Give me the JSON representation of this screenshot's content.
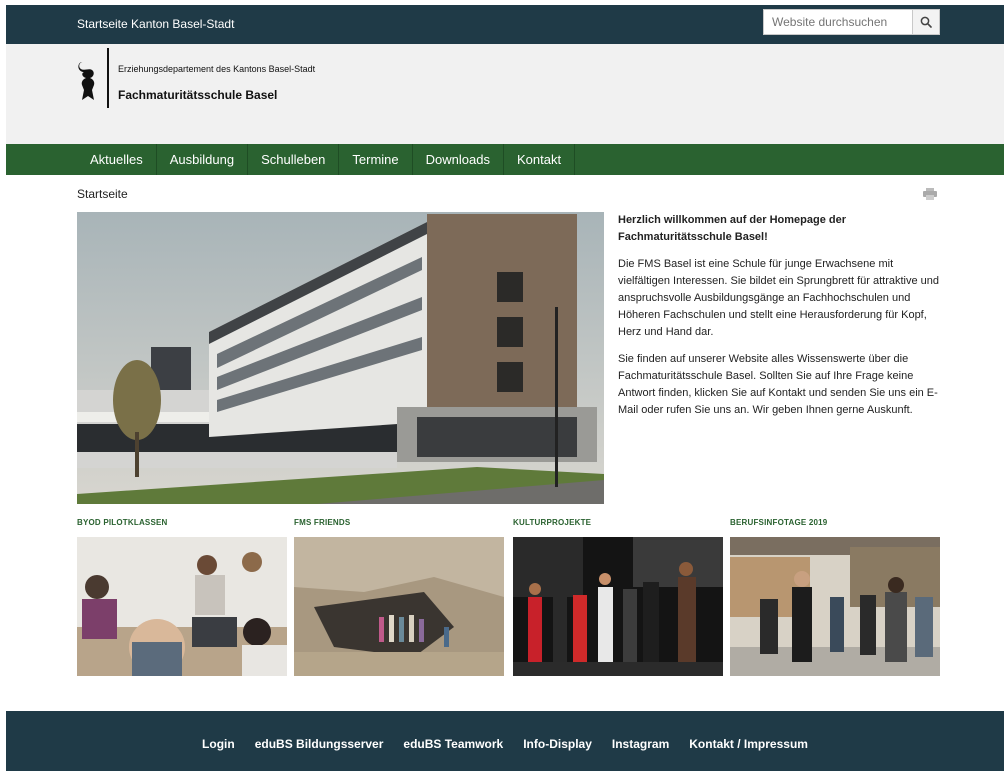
{
  "topbar": {
    "site_link": "Startseite Kanton Basel-Stadt",
    "search": {
      "placeholder": "Website durchsuchen",
      "button_icon": "search-icon"
    }
  },
  "header": {
    "department": "Erziehungsdepartement des Kantons Basel-Stadt",
    "school": "Fachmaturitätsschule Basel",
    "logo_icon": "baselstab-logo"
  },
  "nav": {
    "items": [
      {
        "label": "Aktuelles"
      },
      {
        "label": "Ausbildung"
      },
      {
        "label": "Schulleben"
      },
      {
        "label": "Termine"
      },
      {
        "label": "Downloads"
      },
      {
        "label": "Kontakt"
      }
    ]
  },
  "breadcrumb": "Startseite",
  "print_icon": "print-icon",
  "intro": {
    "heading": "Herzlich willkommen auf der Homepage der Fachmaturitätsschule Basel!",
    "p1": "Die FMS Basel ist eine Schule für junge Erwachsene mit vielfältigen Interessen. Sie bildet ein Sprungbrett für attraktive und anspruchsvolle Ausbildungsgänge an Fachhochschulen und Höheren Fachschulen und stellt eine Herausforderung für Kopf, Herz und Hand dar.",
    "p2": "Sie finden auf unserer Website alles Wissenswerte über die Fachmaturitätsschule Basel. Sollten Sie auf Ihre Frage keine Antwort finden, klicken Sie auf Kontakt und senden Sie uns ein E-Mail oder rufen Sie uns an. Wir geben Ihnen gerne Auskunft."
  },
  "tiles": [
    {
      "title": "BYOD PILOTKLASSEN"
    },
    {
      "title": "FMS FRIENDS"
    },
    {
      "title": "KULTURPROJEKTE"
    },
    {
      "title": "BERUFSINFOTAGE 2019"
    }
  ],
  "footer": {
    "links": [
      {
        "label": "Login"
      },
      {
        "label": "eduBS Bildungsserver"
      },
      {
        "label": "eduBS Teamwork"
      },
      {
        "label": "Info-Display"
      },
      {
        "label": "Instagram"
      },
      {
        "label": "Kontakt / Impressum"
      }
    ]
  },
  "colors": {
    "topbar": "#1f3a47",
    "header_bg": "#f1f1f1",
    "nav_green": "#2a6230",
    "tile_title_green": "#2a6230",
    "footer": "#1f3a47"
  }
}
